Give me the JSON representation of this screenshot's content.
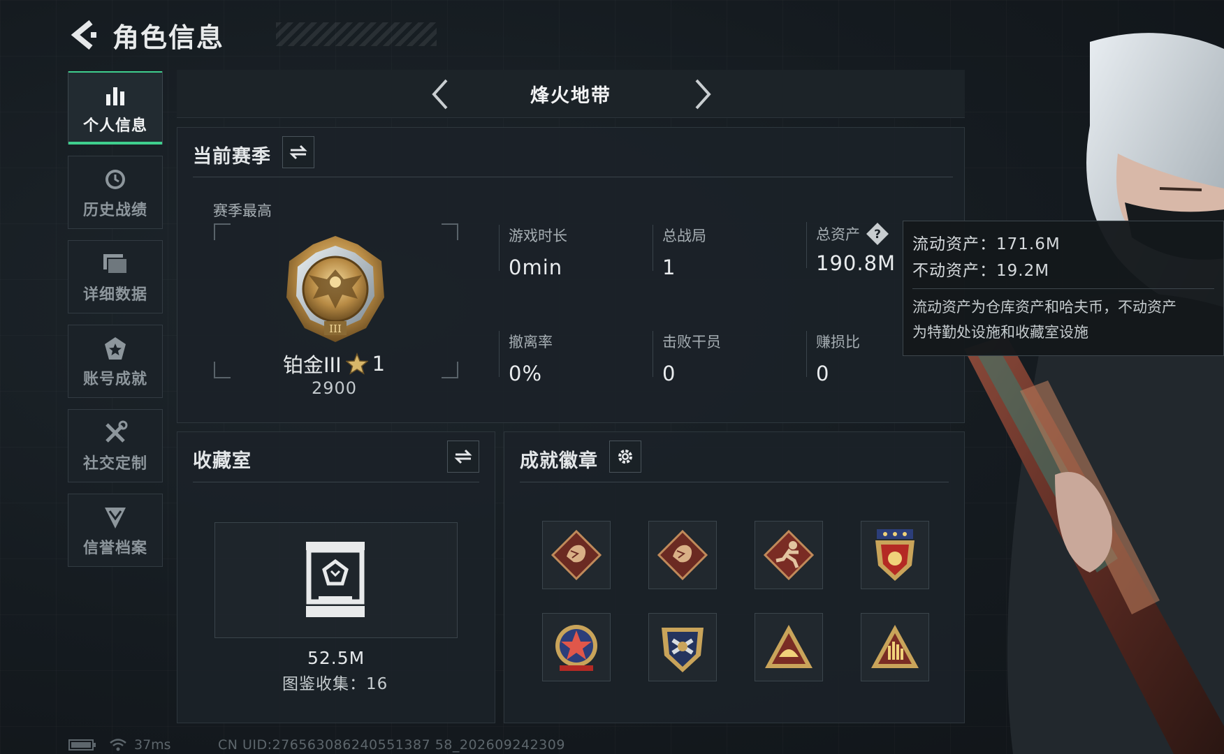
{
  "header": {
    "title": "角色信息"
  },
  "sidebar": {
    "items": [
      {
        "label": "个人信息",
        "icon": "bar-chart-icon",
        "active": true
      },
      {
        "label": "历史战绩",
        "icon": "clock-icon",
        "active": false
      },
      {
        "label": "详细数据",
        "icon": "folder-icon",
        "active": false
      },
      {
        "label": "账号成就",
        "icon": "star-badge-icon",
        "active": false
      },
      {
        "label": "社交定制",
        "icon": "tools-icon",
        "active": false
      },
      {
        "label": "信誉档案",
        "icon": "shield-chevron-icon",
        "active": false
      }
    ]
  },
  "mode": {
    "title": "烽火地带"
  },
  "season": {
    "title": "当前赛季",
    "best_label": "赛季最高",
    "rank_name": "铂金III",
    "rank_stars": "1",
    "rank_score": "2900",
    "stats": {
      "play_time": {
        "label": "游戏时长",
        "value": "0min"
      },
      "total_matches": {
        "label": "总战局",
        "value": "1"
      },
      "total_assets": {
        "label": "总资产",
        "value": "190.8M"
      },
      "extract_rate": {
        "label": "撤离率",
        "value": "0%"
      },
      "operators_defeated": {
        "label": "击败干员",
        "value": "0"
      },
      "profit_ratio": {
        "label": "赚损比",
        "value": "0"
      }
    }
  },
  "tooltip": {
    "liquid": "流动资产：171.6M",
    "fixed": "不动资产：19.2M",
    "desc_line1": "流动资产为仓库资产和哈夫币，不动资产",
    "desc_line2": "为特勤处设施和收藏室设施"
  },
  "collection": {
    "title": "收藏室",
    "value": "52.5M",
    "count": "图鉴收集：16"
  },
  "achievements": {
    "title": "成就徽章",
    "badges": [
      "dragon-badge-icon",
      "dragon-badge-icon",
      "runner-badge-icon",
      "shield-stars-badge-icon",
      "star-emblem-badge-icon",
      "eagle-shield-badge-icon",
      "triangle-helmet-badge-icon",
      "triangle-hand-badge-icon"
    ]
  },
  "status": {
    "ping": "37ms",
    "uid": "CN UID:276563086240551387 58_202609242309"
  },
  "colors": {
    "accent": "#3fcf8e",
    "gold": "#c9a45a",
    "panel": "#1b2228"
  }
}
